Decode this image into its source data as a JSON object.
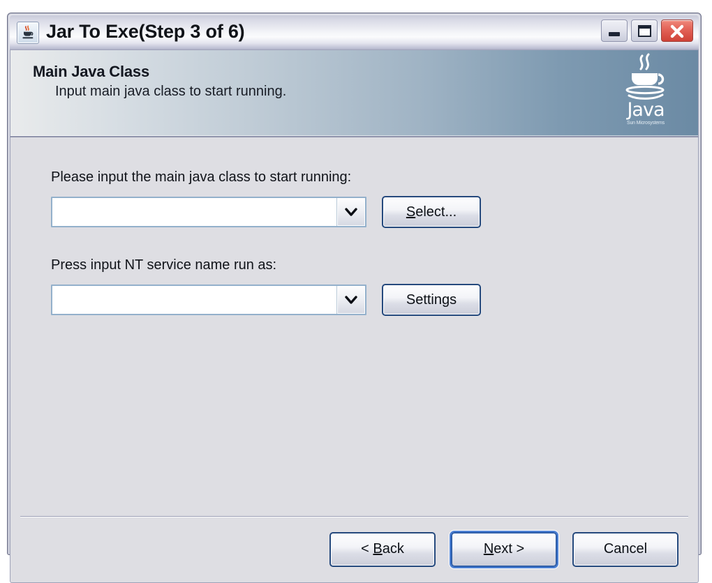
{
  "window": {
    "title": "Jar To Exe(Step 3 of 6)",
    "icon": "java-cup-icon",
    "controls": {
      "minimize": "Minimize",
      "maximize": "Maximize",
      "close": "Close"
    }
  },
  "banner": {
    "title": "Main Java Class",
    "subtitle": "Input main java class to start running.",
    "logo_wordmark": "Java",
    "logo_tagline": "Sun Microsystems",
    "gradient_from": "#e9ebec",
    "gradient_to": "#6b8aa4"
  },
  "form": {
    "main_class": {
      "label": "Please input the main java class to start running:",
      "value": "",
      "placeholder": "",
      "button_label": "Select...",
      "button_mnemonic": "S"
    },
    "service_name": {
      "label": "Press input NT service name run as:",
      "value": "",
      "placeholder": "",
      "button_label": "Settings",
      "button_mnemonic": ""
    }
  },
  "footer": {
    "back_label": "< Back",
    "back_prefix": "< ",
    "back_mnemonic": "B",
    "back_suffix": "ack",
    "next_prefix": "",
    "next_mnemonic": "N",
    "next_suffix": "ext >",
    "cancel_label": "Cancel"
  },
  "theme": {
    "panel_bg": "#dedee3",
    "button_border": "#25497d",
    "combo_border": "#93b0cb",
    "default_button_glow": "#4a7fd4",
    "close_button_red": "#cf4237"
  }
}
